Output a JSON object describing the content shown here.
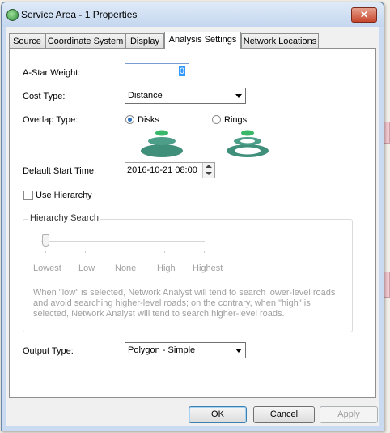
{
  "window": {
    "title": "Service Area - 1  Properties",
    "close_label": "✕"
  },
  "tabs": [
    {
      "label": "Source"
    },
    {
      "label": "Coordinate System"
    },
    {
      "label": "Display"
    },
    {
      "label": "Analysis Settings",
      "active": true
    },
    {
      "label": "Network Locations"
    }
  ],
  "form": {
    "astar_label": "A-Star Weight:",
    "astar_value": "0",
    "cost_label": "Cost Type:",
    "cost_value": "Distance",
    "overlap_label": "Overlap Type:",
    "overlap_disks": "Disks",
    "overlap_rings": "Rings",
    "overlap_selected": "Disks",
    "start_time_label": "Default Start Time:",
    "start_time_value": "2016-10-21 08:00",
    "use_hierarchy_label": "Use Hierarchy",
    "use_hierarchy_checked": false,
    "output_label": "Output Type:",
    "output_value": "Polygon - Simple"
  },
  "hierarchy": {
    "title": "Hierarchy Search",
    "ticks": [
      "Lowest",
      "Low",
      "None",
      "High",
      "Highest"
    ],
    "slider_level": "Lowest",
    "description": "When \"low\" is selected, Network Analyst will tend to search lower-level roads and avoid searching higher-level roads; on the contrary, when \"high\" is selected, Network Analyst will tend to search higher-level roads."
  },
  "buttons": {
    "ok": "OK",
    "cancel": "Cancel",
    "apply": "Apply"
  },
  "colors": {
    "disk_dark": "#3f8f7a",
    "disk_light": "#39b86a",
    "ring_bg": "#3f8f7a"
  }
}
